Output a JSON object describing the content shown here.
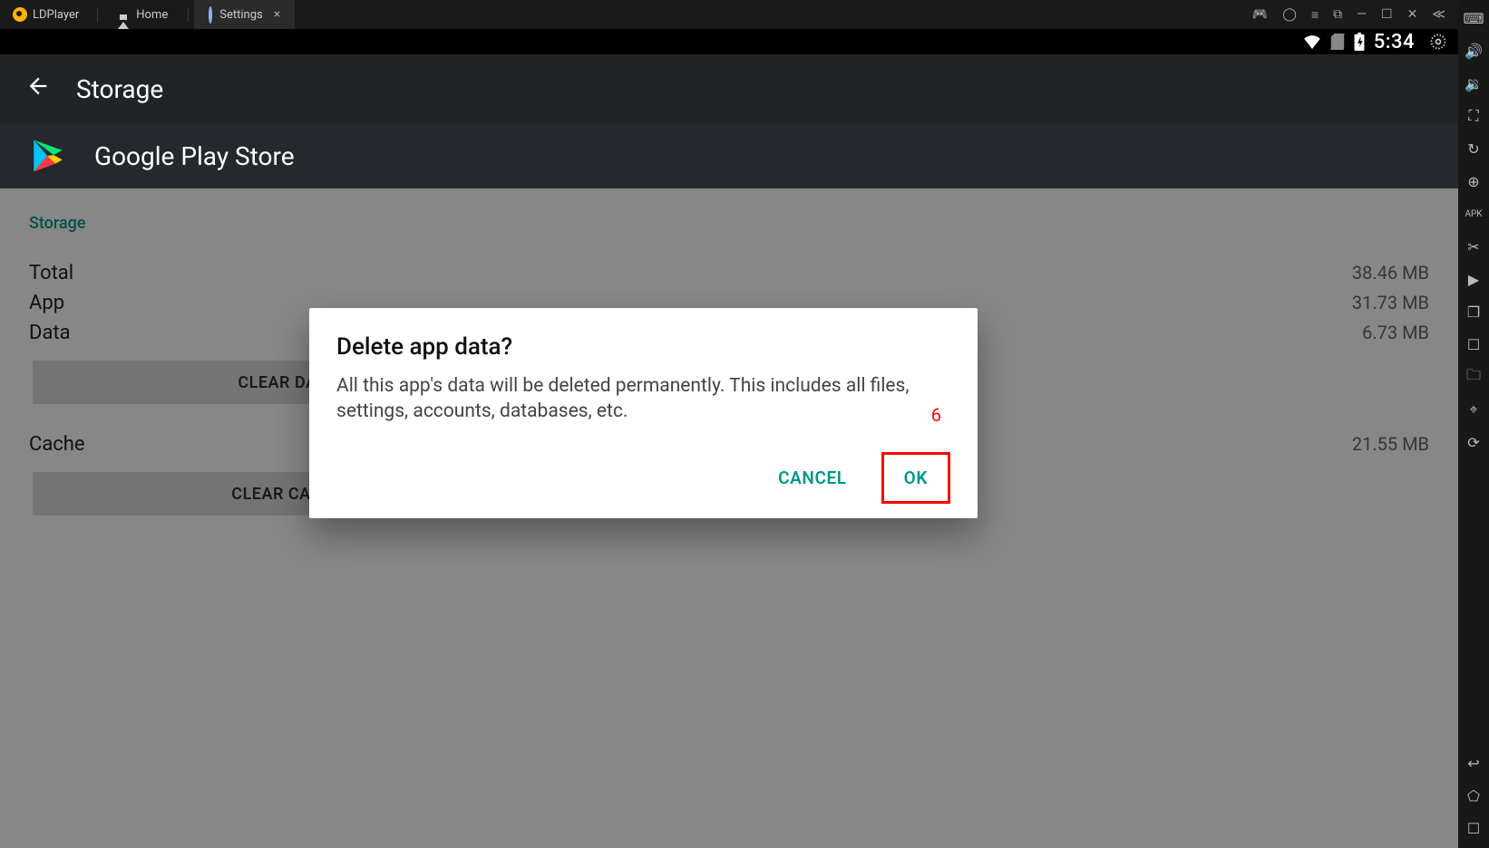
{
  "titlebar": {
    "brand": "LDPlayer",
    "tabs": [
      {
        "label": "Home",
        "active": false
      },
      {
        "label": "Settings",
        "active": true
      }
    ]
  },
  "statusbar": {
    "time": "5:34"
  },
  "header": {
    "page_title": "Storage",
    "app_name": "Google Play Store"
  },
  "storage": {
    "section_label": "Storage",
    "rows": {
      "total": {
        "label": "Total",
        "value": "38.46 MB"
      },
      "app": {
        "label": "App",
        "value": "31.73 MB"
      },
      "data": {
        "label": "Data",
        "value": "6.73 MB"
      },
      "cache": {
        "label": "Cache",
        "value": "21.55 MB"
      }
    },
    "buttons": {
      "clear_data": "CLEAR DATA",
      "clear_cache": "CLEAR CACHE"
    }
  },
  "dialog": {
    "title": "Delete app data?",
    "body": "All this app's data will be deleted permanently. This includes all files, settings, accounts, databases, etc.",
    "cancel": "CANCEL",
    "ok": "OK",
    "annotation": "6"
  },
  "sidebar": {
    "icons": [
      "keyboard-icon",
      "volume-up-icon",
      "volume-down-icon",
      "fullscreen-icon",
      "sync-icon",
      "add-instance-icon",
      "apk-install-icon",
      "cut-icon",
      "play-controls-icon",
      "multi-instance-icon",
      "settings-sidebar-icon",
      "shared-folder-icon",
      "gps-icon",
      "rotate-icon"
    ],
    "bottom": [
      "back-sys-icon",
      "home-sys-icon",
      "recents-sys-icon"
    ]
  }
}
